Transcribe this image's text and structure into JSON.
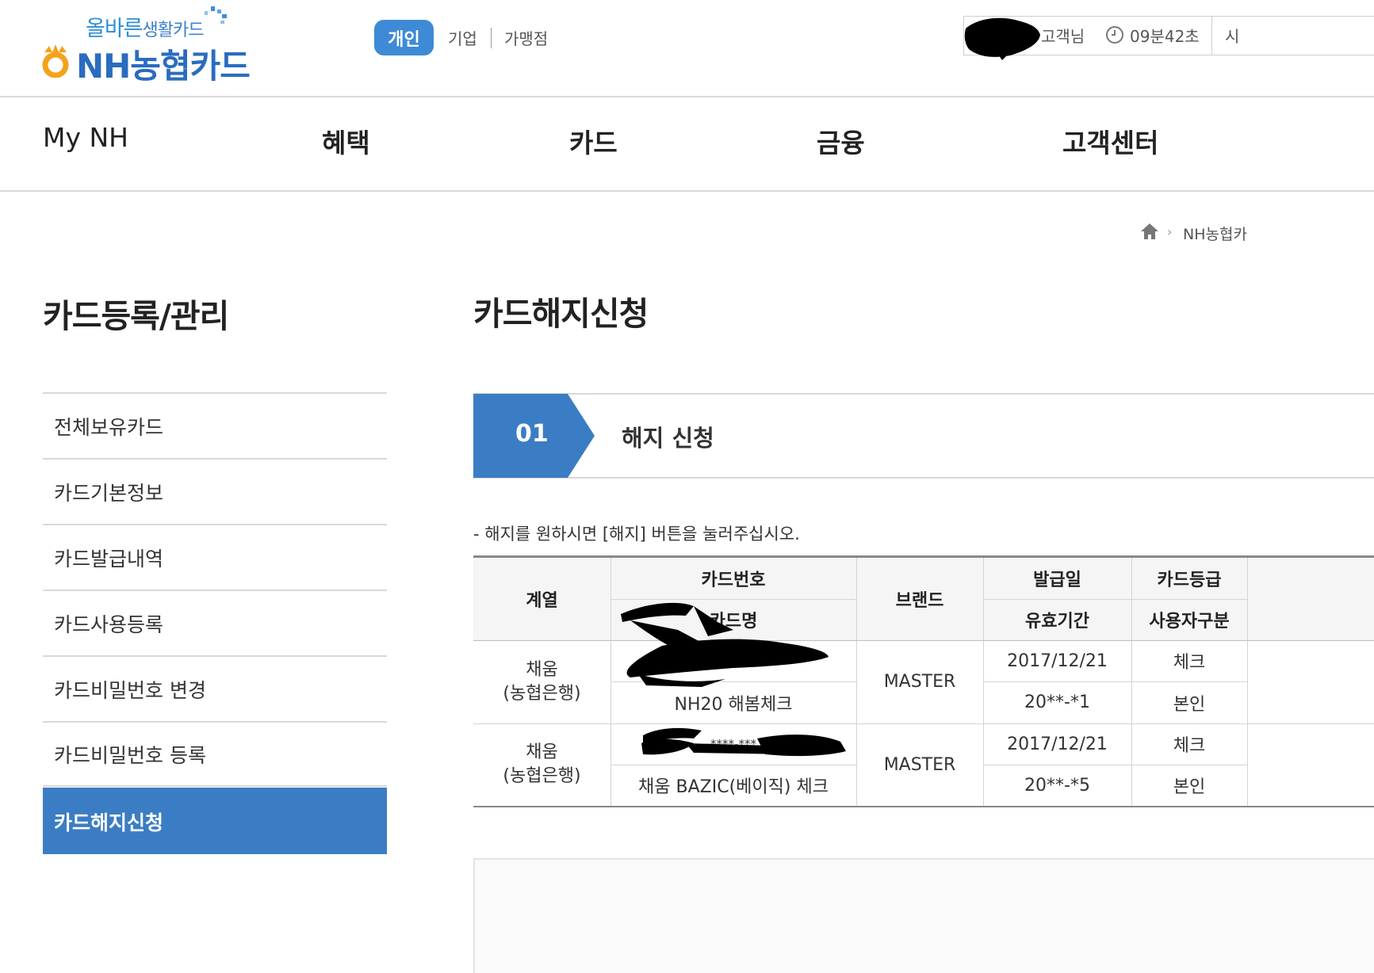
{
  "header": {
    "logo": {
      "slogan_part1": "올바른",
      "slogan_part2": "생활카드",
      "brand": "NH농협카드"
    },
    "segments": {
      "personal": "개인",
      "business": "기업",
      "merchant": "가맹점"
    },
    "user": {
      "name_suffix": "고객님",
      "timer": "09분42초",
      "extend_label": "시"
    }
  },
  "gnb": {
    "items": [
      "My NH",
      "혜택",
      "카드",
      "금융",
      "고객센터"
    ]
  },
  "breadcrumb": {
    "items": [
      "NH농협카"
    ]
  },
  "sidebar": {
    "title": "카드등록/관리",
    "items": [
      {
        "label": "전체보유카드",
        "active": false
      },
      {
        "label": "카드기본정보",
        "active": false
      },
      {
        "label": "카드발급내역",
        "active": false
      },
      {
        "label": "카드사용등록",
        "active": false
      },
      {
        "label": "카드비밀번호 변경",
        "active": false
      },
      {
        "label": "카드비밀번호 등록",
        "active": false
      },
      {
        "label": "카드해지신청",
        "active": true
      }
    ]
  },
  "main": {
    "title": "카드해지신청",
    "step": {
      "number": "01",
      "label": "해지 신청"
    },
    "notice": "- 해지를 원하시면 [해지] 버튼을 눌러주십시오.",
    "table": {
      "headers": {
        "series": "계열",
        "card_number": "카드번호",
        "card_name": "카드명",
        "brand": "브랜드",
        "issue_date": "발급일",
        "expiry": "유효기간",
        "grade": "카드등급",
        "user_type": "사용자구분"
      },
      "rows": [
        {
          "series_line1": "채움",
          "series_line2": "(농협은행)",
          "card_number": "",
          "card_name": "NH20 해봄체크",
          "brand": "MASTER",
          "issue_date": "2017/12/21",
          "expiry": "20**-*1",
          "grade": "체크",
          "user_type": "본인"
        },
        {
          "series_line1": "채움",
          "series_line2": "(농협은행)",
          "card_number": "****-***",
          "card_name": "채움 BAZIC(베이직) 체크",
          "brand": "MASTER",
          "issue_date": "2017/12/21",
          "expiry": "20**-*5",
          "grade": "체크",
          "user_type": "본인"
        }
      ]
    }
  },
  "colors": {
    "accent_blue": "#3b7dc4",
    "segment_blue": "#3e8ad6",
    "logo_orange": "#f3a21b",
    "redaction": "#000000"
  }
}
